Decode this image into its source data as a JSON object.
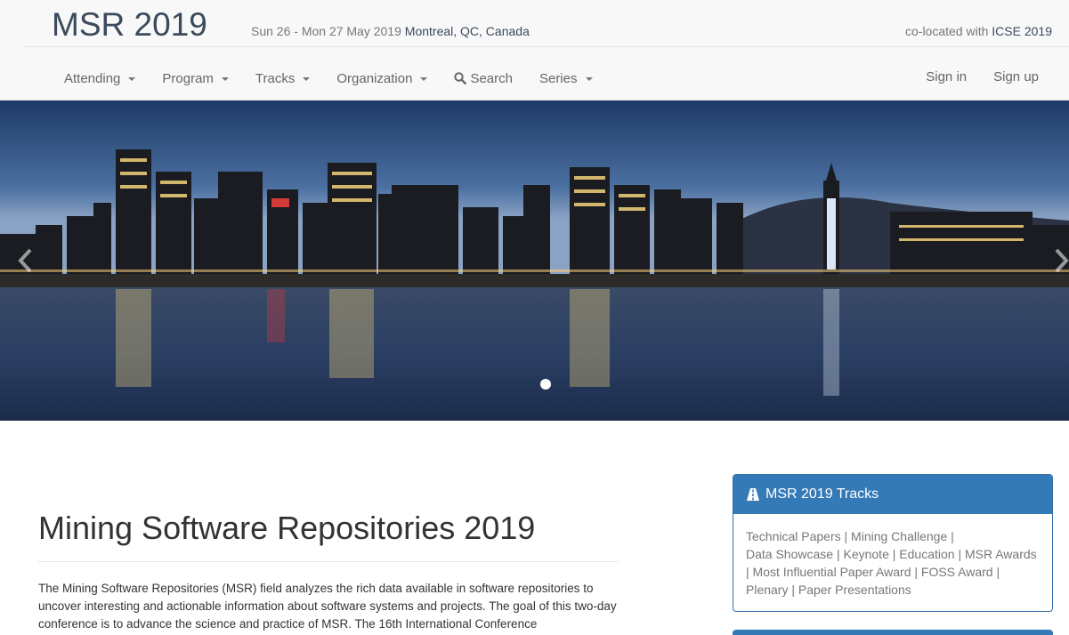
{
  "header": {
    "brand": "MSR 2019",
    "dates": "Sun 26 - Mon 27 May 2019",
    "location": "Montreal, QC, Canada",
    "colocated_prefix": "co-located with",
    "colocated_link": "ICSE 2019"
  },
  "nav": {
    "items": [
      {
        "label": "Attending"
      },
      {
        "label": "Program"
      },
      {
        "label": "Tracks"
      },
      {
        "label": "Organization"
      },
      {
        "label": "Search"
      },
      {
        "label": "Series"
      }
    ],
    "sign_in": "Sign in",
    "sign_up": "Sign up"
  },
  "main": {
    "title": "Mining Software Repositories 2019",
    "intro": "The Mining Software Repositories (MSR) field analyzes the rich data available in software repositories to uncover interesting and actionable information about software systems and projects. The goal of this two-day conference is to advance the science and practice of MSR. The 16th International Conference"
  },
  "sidebar": {
    "panel_title": "MSR 2019 Tracks",
    "tracks": [
      "Technical Papers",
      "Mining Challenge",
      "Data Showcase",
      "Keynote",
      "Education",
      "MSR Awards",
      "Most Influential Paper Award",
      "FOSS Award",
      "Plenary",
      "Paper Presentations"
    ]
  },
  "colors": {
    "brand_text": "#3b4a5c",
    "panel_blue": "#337ab7",
    "nav_text": "#666666"
  }
}
